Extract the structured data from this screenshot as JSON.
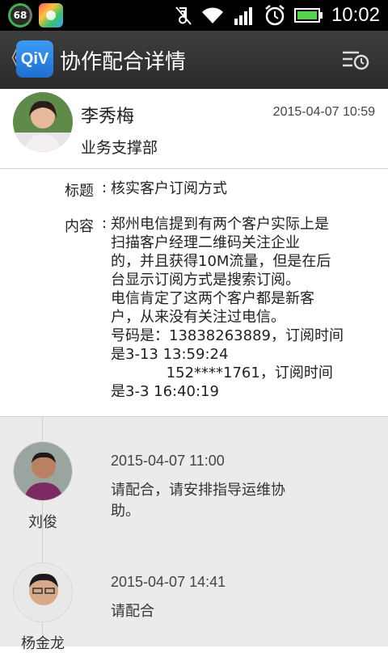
{
  "status_bar": {
    "battery_percent": "68",
    "time": "10:02",
    "icons": [
      "battery-circle-icon",
      "app-store-icon",
      "muted-icon",
      "wifi-icon",
      "signal-icon",
      "alarm-icon",
      "battery-icon"
    ]
  },
  "action_bar": {
    "back_glyph": "《",
    "logo_text": "QiV",
    "title": "协作配合详情",
    "history_icon": "history-icon"
  },
  "header": {
    "author_name": "李秀梅",
    "department": "业务支撑部",
    "time": "2015-04-07 10:59"
  },
  "content": {
    "title_label": "标题",
    "title_value": "核实客户订阅方式",
    "body_label": "内容",
    "body_lines": [
      "郑州电信提到有两个客户实际上是",
      "扫描客户经理二维码关注企业",
      "的，并且获得10M流量，但是在后",
      "台显示订阅方式是搜索订阅。",
      "电信肯定了这两个客户都是新客",
      "户，从来没有关注过电信。",
      "号码是：13838263889，订阅时间",
      "是3-13 13:59:24",
      "            152****1761，订阅时间",
      "是3-3 16:40:19"
    ]
  },
  "timeline": [
    {
      "name": "刘俊",
      "time": "2015-04-07 11:00",
      "lines": [
        "请配合，请安排指导运维协",
        "助。"
      ]
    },
    {
      "name": "杨金龙",
      "time": "2015-04-07 14:41",
      "lines": [
        "请配合"
      ]
    }
  ],
  "colors": {
    "status_bar": "#000000",
    "action_bar": "#333333",
    "logo": "#2a84e6",
    "timeline_bg": "#ebebeb"
  }
}
